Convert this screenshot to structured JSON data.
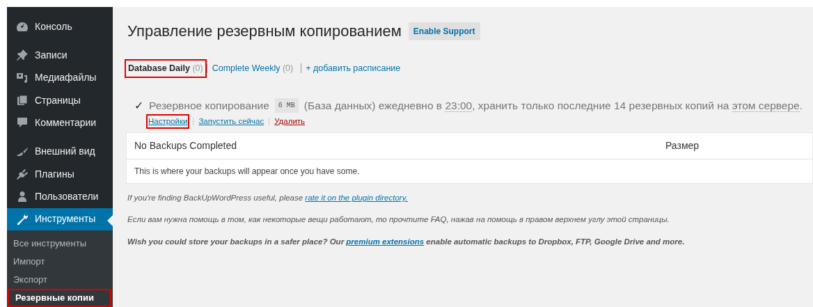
{
  "sidebar": {
    "items": [
      {
        "label": "Консоль",
        "selected": false,
        "separator_before": false
      },
      {
        "label": "Записи",
        "selected": false,
        "separator_before": true
      },
      {
        "label": "Медиафайлы",
        "selected": false,
        "separator_before": false
      },
      {
        "label": "Страницы",
        "selected": false,
        "separator_before": false
      },
      {
        "label": "Комментарии",
        "selected": false,
        "separator_before": false
      },
      {
        "label": "Внешний вид",
        "selected": false,
        "separator_before": true
      },
      {
        "label": "Плагины",
        "selected": false,
        "separator_before": false
      },
      {
        "label": "Пользователи",
        "selected": false,
        "separator_before": false
      },
      {
        "label": "Инструменты",
        "selected": true,
        "separator_before": false
      }
    ],
    "submenu": [
      {
        "label": "Все инструменты",
        "selected": false,
        "highlighted": false
      },
      {
        "label": "Импорт",
        "selected": false,
        "highlighted": false
      },
      {
        "label": "Экспорт",
        "selected": false,
        "highlighted": false
      },
      {
        "label": "Резервные копии",
        "selected": true,
        "highlighted": true
      }
    ]
  },
  "title": "Управление резервным копированием",
  "support_button": "Enable Support",
  "tabs": [
    {
      "label": "Database Daily",
      "count": "(0)",
      "selected": true,
      "highlighted": true
    },
    {
      "label": "Complete Weekly",
      "count": "(0)",
      "selected": false,
      "highlighted": false
    }
  ],
  "add_schedule": "+ добавить расписание",
  "schedule": {
    "check": "✓",
    "before": "Резервное копирование",
    "size": "6 MB",
    "after": [
      {
        "text": "(База данных) ежедневно в ",
        "dotted": false
      },
      {
        "text": "23:00",
        "dotted": true
      },
      {
        "text": ", хранить только последние 14 резервных копий на ",
        "dotted": false
      },
      {
        "text": "этом сервере",
        "dotted": true
      },
      {
        "text": ".",
        "dotted": false
      }
    ]
  },
  "actions": [
    {
      "label": "Настройки",
      "kind": "normal",
      "highlighted": true
    },
    {
      "label": "Запустить сейчас",
      "kind": "normal",
      "highlighted": false
    },
    {
      "label": "Удалить",
      "kind": "danger",
      "highlighted": false
    }
  ],
  "table": {
    "columns": [
      "No Backups Completed",
      "Размер"
    ],
    "empty_message": "This is where your backups will appear once you have some."
  },
  "notes": [
    {
      "before": "If you're finding BackUpWordPress useful, please ",
      "link": "rate it on the plugin directory.",
      "bold": false
    },
    {
      "before": "Если вам нужна помощь в том, как некоторые вещи работают, то прочтите FAQ, нажав на помощь в правом верхнем углу этой страницы.",
      "bold": false
    },
    {
      "before": "Wish you could store your backups in a safer place? Our ",
      "link": "premium extensions",
      "after": " enable automatic backups to Dropbox, FTP, Google Drive and more.",
      "bold": true
    }
  ]
}
